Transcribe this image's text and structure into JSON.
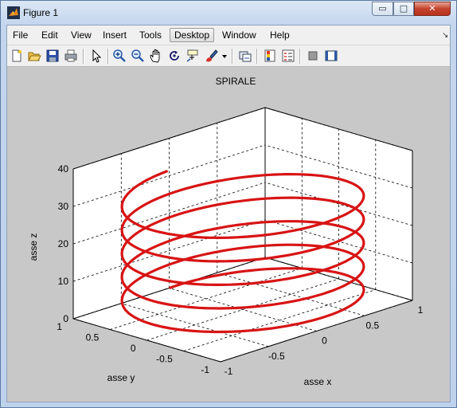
{
  "window": {
    "title": "Figure 1"
  },
  "titlebar_buttons": {
    "minimize": "▭",
    "maximize": "□",
    "close": "✕"
  },
  "menu": [
    "File",
    "Edit",
    "View",
    "Insert",
    "Tools",
    "Desktop",
    "Window",
    "Help"
  ],
  "active_menu": "Desktop",
  "toolbar_icons": [
    "new-figure",
    "open-file",
    "save",
    "print",
    "edit-plot-arrow",
    "zoom-in",
    "zoom-out",
    "pan-hand",
    "rotate-3d",
    "data-cursor",
    "brush",
    "brush-dropdown",
    "link-plot",
    "insert-colorbar",
    "insert-legend",
    "hide-plot-tools",
    "show-plot-tools"
  ],
  "colors": {
    "line": "#d81414",
    "axes_bg": "#ffffff",
    "figure_bg": "#c8c8c8"
  },
  "plot": {
    "title": "SPIRALE",
    "xlabel": "asse x",
    "ylabel": "asse y",
    "zlabel": "asse z",
    "x_ticks": [
      "-1",
      "-0.5",
      "0",
      "0.5",
      "1"
    ],
    "y_ticks": [
      "1",
      "0.5",
      "0",
      "-0.5",
      "-1"
    ],
    "z_ticks": [
      "0",
      "10",
      "20",
      "30",
      "40"
    ]
  },
  "chart_data": {
    "type": "line",
    "title": "SPIRALE",
    "xlabel": "asse x",
    "ylabel": "asse y",
    "zlabel": "asse z",
    "projection": "3d",
    "xlim": [
      -1,
      1
    ],
    "ylim": [
      -1,
      1
    ],
    "zlim": [
      0,
      40
    ],
    "grid": true,
    "series": [
      {
        "x_expr": "sin(t)",
        "y_expr": "cos(t)",
        "z_expr": "t",
        "t_range": [
          0,
          31.4
        ],
        "color": "#d81414"
      }
    ]
  }
}
